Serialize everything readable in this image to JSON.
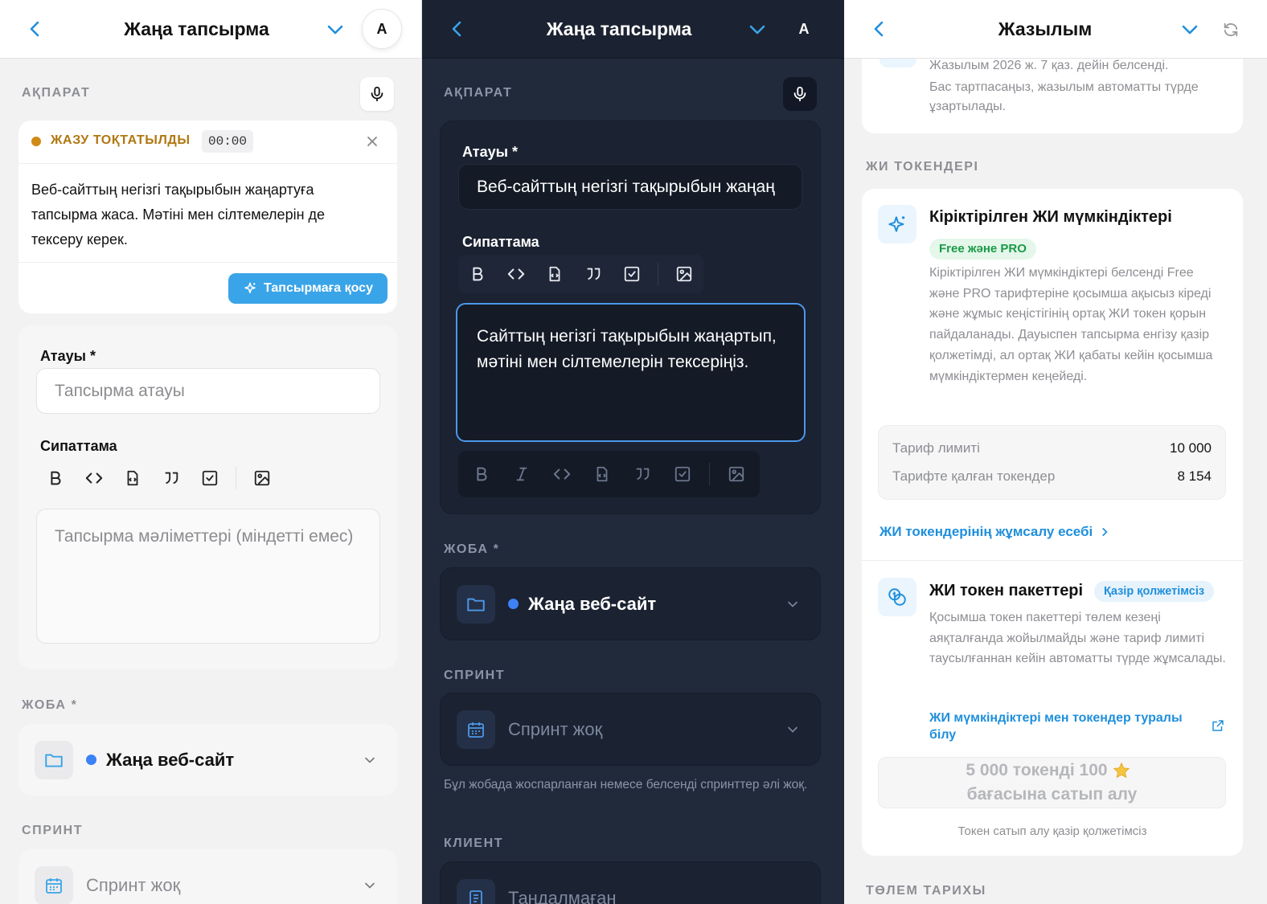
{
  "panel1": {
    "title": "Жаңа тапсырма",
    "avatar": "A",
    "section_info": "АҚПАРАТ",
    "recording": {
      "status": "ЖАЗУ ТОҚТАТЫЛДЫ",
      "time": "00:00",
      "transcript": "Веб-сайттың негізгі тақырыбын жаңартуға тапсырма жаса. Мәтіні мен сілтемелерін де тексеру керек.",
      "add_button": "Тапсырмаға қосу"
    },
    "name_label": "Атауы *",
    "name_placeholder": "Тапсырма атауы",
    "desc_label": "Сипаттама",
    "desc_placeholder": "Тапсырма мәліметтері (міндетті емес)",
    "section_project": "ЖОБА *",
    "project_value": "Жаңа веб-сайт",
    "section_sprint": "СПРИНТ",
    "sprint_value": "Спринт жоқ"
  },
  "panel2": {
    "title": "Жаңа тапсырма",
    "avatar": "A",
    "section_info": "АҚПАРАТ",
    "name_label": "Атауы *",
    "name_value": "Веб-сайттың негізгі тақырыбын жаңаң",
    "desc_label": "Сипаттама",
    "desc_value": "Сайттың негізгі тақырыбын жаңартып, мәтіні мен сілтемелерін тексеріңіз.",
    "section_project": "ЖОБА *",
    "project_value": "Жаңа веб-сайт",
    "section_sprint": "СПРИНТ",
    "sprint_value": "Спринт жоқ",
    "sprint_hint": "Бұл жобада жоспарланған немесе белсенді спринттер әлі жоқ.",
    "section_client": "КЛИЕНТ",
    "client_value": "Таңдалмаған"
  },
  "panel3": {
    "title": "Жазылым",
    "sub_active": "Жазылым 2026 ж. 7 қаз. дейін белсенді.",
    "sub_renew": "Бас тартпасаңыз, жазылым автоматты түрде ұзартылады.",
    "section_ai": "ЖИ ТОКЕНДЕРІ",
    "builtin_title": "Кіріктірілген ЖИ мүмкіндіктері",
    "builtin_badge": "Free және PRO",
    "builtin_desc": "Кіріктірілген ЖИ мүмкіндіктері белсенді Free және PRO тарифтеріне қосымша ақысыз кіреді және жұмыс кеңістігінің ортақ ЖИ токен қорын пайдаланады. Дауыспен тапсырма енгізу қазір қолжетімді, ал ортақ ЖИ қабаты кейін қосымша мүмкіндіктермен кеңейеді.",
    "limit_label": "Тариф лимиті",
    "limit_value": "10 000",
    "remaining_label": "Тарифте қалған токендер",
    "remaining_value": "8 154",
    "usage_link": "ЖИ токендерінің жұмсалу есебі",
    "packs_title": "ЖИ токен пакеттері",
    "packs_badge": "Қазір қолжетімсіз",
    "packs_desc": "Қосымша токен пакеттері төлем кезеңі аяқталғанда жойылмайды және тариф лимиті таусылғаннан кейін автоматты түрде жұмсалады.",
    "learn_link": "ЖИ мүмкіндіктері мен токендер туралы білу",
    "buy_button_a": "5 000 токенді 100",
    "buy_button_b": "бағасына сатып алу",
    "buy_note": "Токен сатып алу қазір қолжетімсіз",
    "section_history": "ТӨЛЕМ ТАРИХЫ"
  },
  "colors": {
    "accent": "#3aa4e8",
    "link": "#1f8fdc",
    "recording": "#d08a17",
    "project_dot": "#3c82f6",
    "dark_bg": "#212a3b",
    "dark_focus": "#4c97e8",
    "badge_green_bg": "#e4f7ea",
    "badge_green_fg": "#1a9a48"
  },
  "icons": [
    "back-chevron-icon",
    "dropdown-chevron-icon",
    "refresh-icon",
    "microphone-icon",
    "close-icon",
    "sparkle-icon",
    "bold-icon",
    "italic-icon",
    "code-icon",
    "code-file-icon",
    "quote-icon",
    "checkbox-icon",
    "image-icon",
    "folder-icon",
    "calendar-icon",
    "coins-icon",
    "external-link-icon",
    "star-icon"
  ]
}
